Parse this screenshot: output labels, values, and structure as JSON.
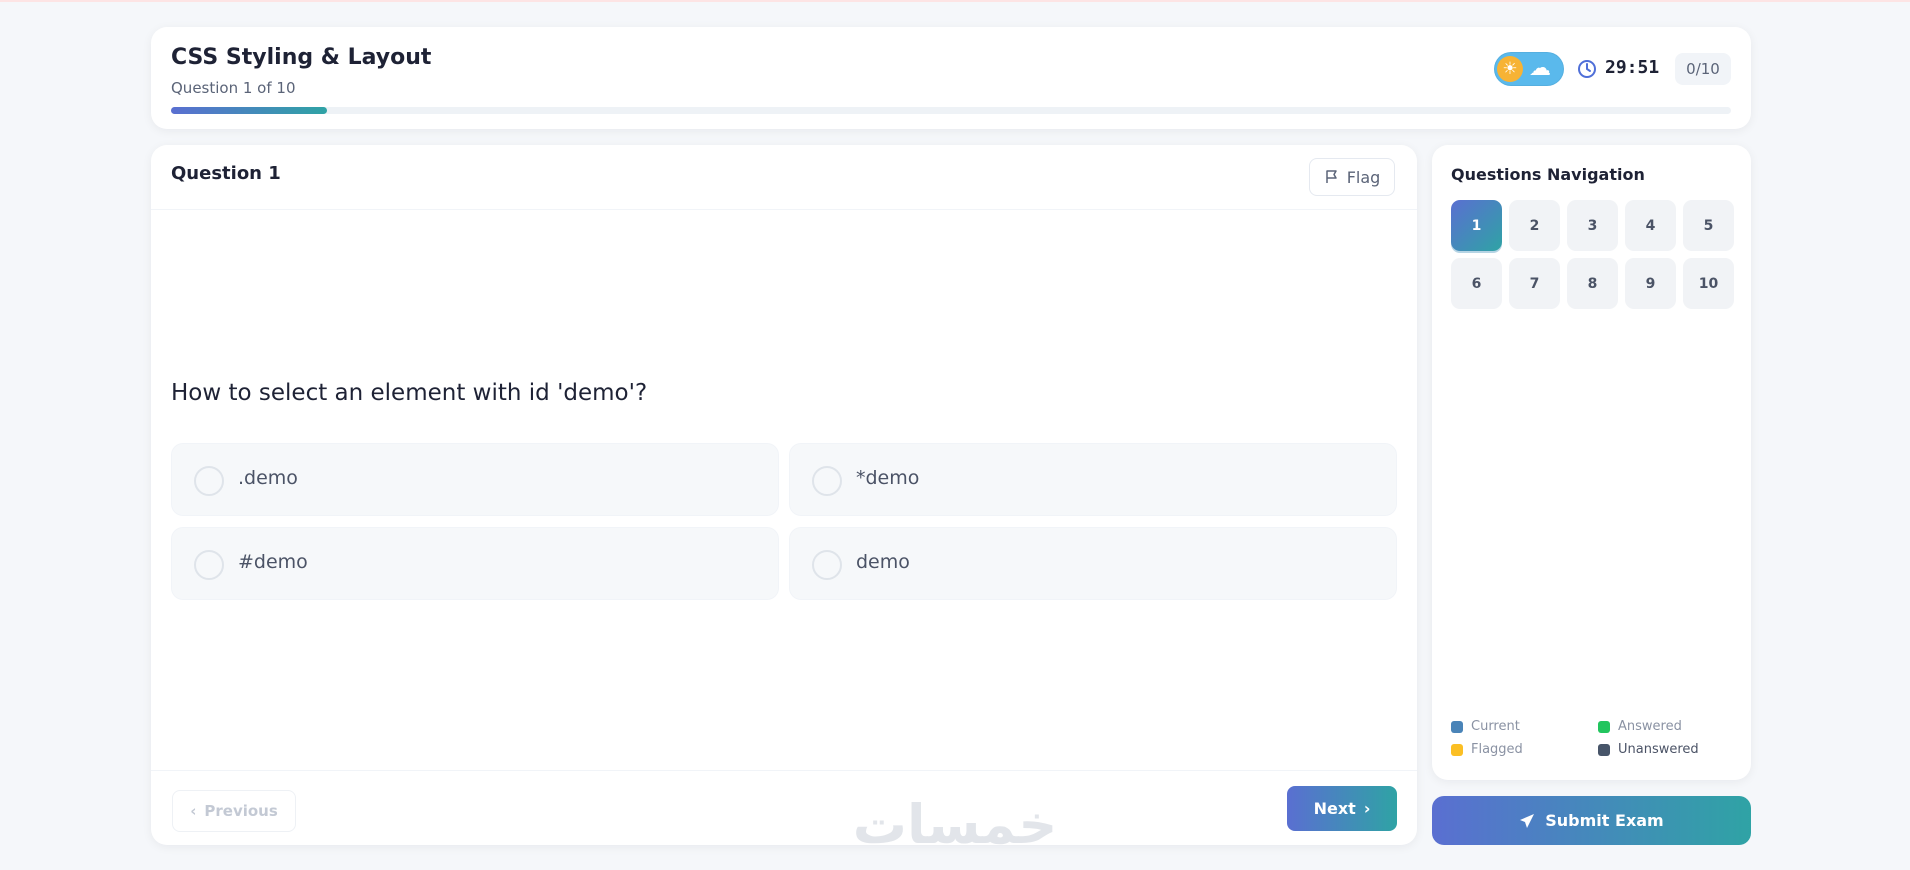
{
  "header": {
    "title": "CSS Styling & Layout",
    "subtitle": "Question 1 of 10",
    "progress_fraction": 0.1,
    "timer": "29:51",
    "score": "0/10",
    "theme_toggle": {
      "mode": "light",
      "sun_icon": "sun-icon",
      "cloud_icon": "cloud-icon"
    }
  },
  "question": {
    "heading": "Question 1",
    "flag_label": "Flag",
    "text": "How to select an element with id 'demo'?",
    "options": [
      ".demo",
      "*demo",
      "#demo",
      "demo"
    ],
    "previous_label": "Previous",
    "next_label": "Next"
  },
  "navigation": {
    "title": "Questions Navigation",
    "numbers": [
      "1",
      "2",
      "3",
      "4",
      "5",
      "6",
      "7",
      "8",
      "9",
      "10"
    ],
    "current": "1",
    "legend": [
      {
        "label": "Current",
        "color": "#4a84b8"
      },
      {
        "label": "Answered",
        "color": "#22c55e"
      },
      {
        "label": "Flagged",
        "color": "#fbbf24"
      },
      {
        "label": "Unanswered",
        "color": "#475569"
      }
    ]
  },
  "submit_label": "Submit Exam",
  "watermark": "خمسات",
  "colors": {
    "accent_start": "#5a6fd1",
    "accent_end": "#2fa3a5",
    "background": "#f5f7fa"
  }
}
